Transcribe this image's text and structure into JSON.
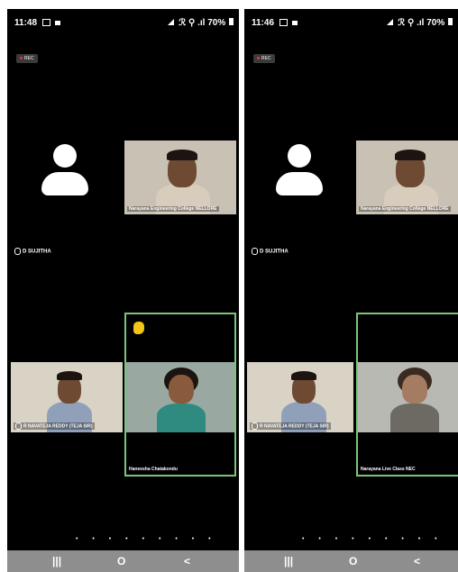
{
  "left_phone": {
    "time": "11:48",
    "status_right": "ℛ ⚲ .ıl 70%",
    "rec_label": "REC",
    "self_name": "D SUJITHA",
    "tiles": {
      "top": "Narayana Engineering College NELLORE",
      "bottom_left": "R NAVATEJA REDDY (TEJA SIR)",
      "bottom_right": "Haneesha Chatakondu"
    },
    "pager": "• • • • • • • • •",
    "nav": {
      "recents": "|||",
      "home": "O",
      "back": "<"
    }
  },
  "right_phone": {
    "time": "11:46",
    "status_right": "ℛ ⚲ .ıl 70%",
    "rec_label": "REC",
    "self_name": "D SUJITHA",
    "tiles": {
      "top": "Narayana Engineering College NELLORE",
      "bottom_left": "R NAVATEJA REDDY (TEJA SIR)",
      "bottom_right": "Narayana Live Class NEC"
    },
    "pager": "• • • • • • • • •",
    "nav": {
      "recents": "|||",
      "home": "O",
      "back": "<"
    }
  },
  "colors": {
    "active_speaker_border": "#79c879",
    "background": "#000000",
    "navbar": "#8e8e8e"
  },
  "icons": [
    "message-icon",
    "video-icon",
    "signal-icon",
    "battery-icon",
    "record-dot-icon",
    "default-avatar-icon",
    "mic-off-icon",
    "raised-hand-icon"
  ]
}
